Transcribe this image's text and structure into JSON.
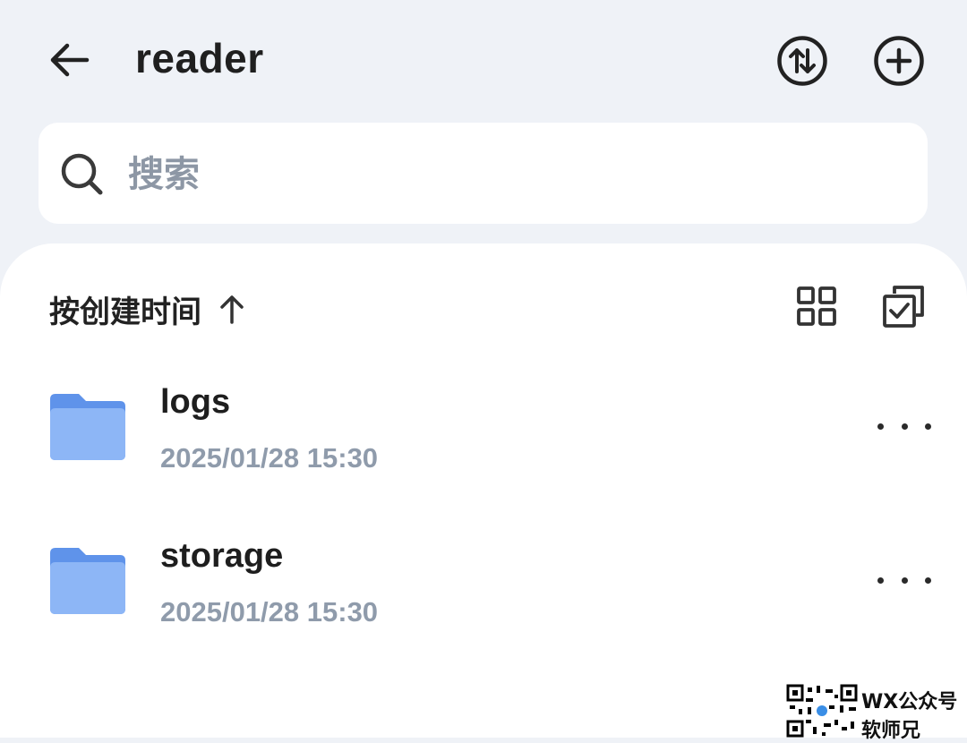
{
  "header": {
    "title": "reader",
    "back_icon": "arrow-left-icon",
    "sort_swap_icon": "swap-vertical-icon",
    "add_icon": "plus-circle-icon"
  },
  "search": {
    "placeholder": "搜索",
    "value": "",
    "icon": "search-icon"
  },
  "toolbar": {
    "sort_label": "按创建时间",
    "sort_direction_icon": "arrow-up-icon",
    "view_icon": "grid-view-icon",
    "select_icon": "multi-select-icon"
  },
  "files": [
    {
      "name": "logs",
      "date": "2025/01/28 15:30",
      "icon": "folder-icon"
    },
    {
      "name": "storage",
      "date": "2025/01/28 15:30",
      "icon": "folder-icon"
    }
  ],
  "watermark": {
    "line1": "WX公众号",
    "line2": "软师兄"
  },
  "colors": {
    "background": "#eff2f7",
    "panel": "#ffffff",
    "folder_back": "#5f93ea",
    "folder_front": "#8db6f6",
    "secondary_text": "#8f9bab"
  }
}
